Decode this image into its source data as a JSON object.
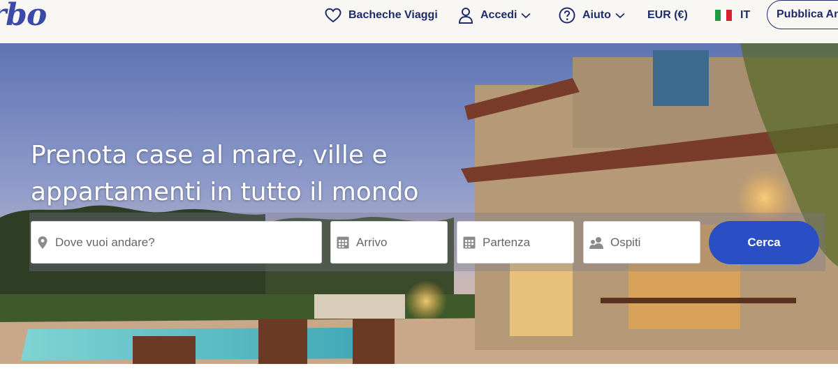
{
  "header": {
    "logo_text": "rbo",
    "nav": {
      "trip_boards": "Bacheche Viaggi",
      "sign_in": "Accedi",
      "help": "Aiuto",
      "currency": "EUR (€)",
      "language": "IT",
      "publish": "Pubblica Annuncio"
    }
  },
  "hero": {
    "headline_line1": "Prenota case al mare, ville e",
    "headline_line2": "appartamenti in tutto il mondo"
  },
  "search": {
    "destination_placeholder": "Dove vuoi andare?",
    "arrival_placeholder": "Arrivo",
    "departure_placeholder": "Partenza",
    "guests_placeholder": "Ospiti",
    "button_label": "Cerca"
  },
  "icons": {
    "trip_boards": "heart-icon",
    "sign_in": "user-icon",
    "help": "help-circle-icon",
    "language": "italy-flag-icon",
    "destination": "map-pin-icon",
    "arrival": "calendar-icon",
    "departure": "calendar-icon",
    "guests": "guests-icon"
  },
  "colors": {
    "brand_navy": "#1f2a6b",
    "logo": "#3b4aa8",
    "search_button": "#2a4fc5",
    "header_bg": "#f9f7f4"
  }
}
